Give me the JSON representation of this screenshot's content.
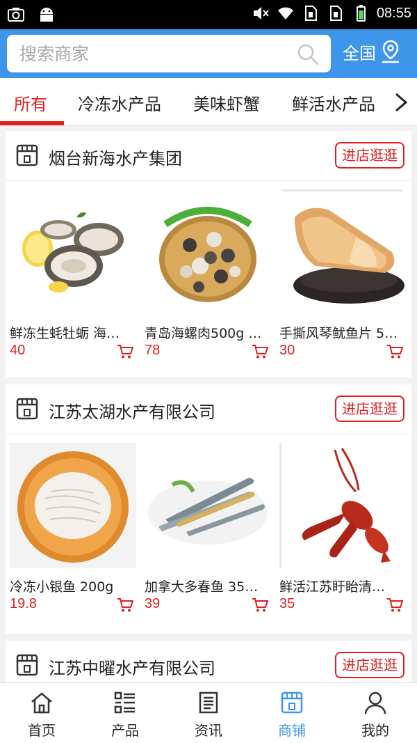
{
  "status_bar": {
    "time": "08:55"
  },
  "search": {
    "placeholder": "搜索商家",
    "region_label": "全国"
  },
  "tabs": [
    "所有",
    "冷冻水产品",
    "美味虾蟹",
    "鲜活水产品"
  ],
  "accent_color": "#e02020",
  "brand_color": "#3d96ea",
  "stores": [
    {
      "name": "烟台新海水产集团",
      "button": "进店逛逛",
      "products": [
        {
          "name": "鲜冻生蚝牡蛎 海…",
          "price": "40"
        },
        {
          "name": "青岛海螺肉500g …",
          "price": "78"
        },
        {
          "name": "手撕风琴鱿鱼片 5…",
          "price": "30"
        }
      ]
    },
    {
      "name": "江苏太湖水产有限公司",
      "button": "进店逛逛",
      "products": [
        {
          "name": "冷冻小银鱼 200g",
          "price": "19.8"
        },
        {
          "name": "加拿大多春鱼 35…",
          "price": "39"
        },
        {
          "name": "鲜活江苏盱眙清…",
          "price": "35"
        }
      ]
    },
    {
      "name": "江苏中曜水产有限公司",
      "button": "进店逛逛"
    }
  ],
  "bottom_nav": [
    {
      "label": "首页",
      "icon": "home-icon"
    },
    {
      "label": "产品",
      "icon": "grid-list-icon"
    },
    {
      "label": "资讯",
      "icon": "news-icon"
    },
    {
      "label": "商铺",
      "icon": "store-icon"
    },
    {
      "label": "我的",
      "icon": "user-icon"
    }
  ]
}
